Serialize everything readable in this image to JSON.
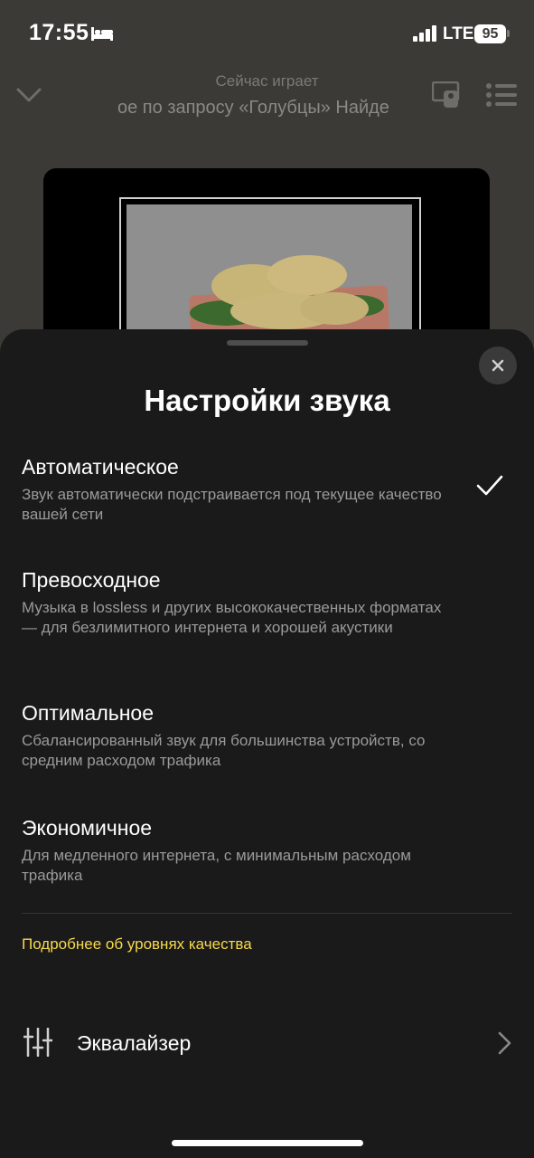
{
  "status": {
    "time": "17:55",
    "network": "LTE",
    "battery": "95"
  },
  "player": {
    "now_playing_label": "Сейчас играет",
    "track_title": "ое по запросу «Голубцы»   Найде"
  },
  "sheet": {
    "title": "Настройки звука",
    "options": [
      {
        "title": "Автоматическое",
        "description": "Звук автоматически подстраивается под текущее качество вашей сети",
        "selected": true
      },
      {
        "title": "Превосходное",
        "description": "Музыка в lossless и других высококачественных форматах — для безлимитного интернета и хорошей акустики",
        "selected": false
      },
      {
        "title": "Оптимальное",
        "description": "Сбалансированный звук для большинства устройств, со средним расходом трафика",
        "selected": false
      },
      {
        "title": "Экономичное",
        "description": "Для медленного интернета, с минимальным расходом трафика",
        "selected": false
      }
    ],
    "more_link": "Подробнее об уровнях качества",
    "equalizer_label": "Эквалайзер"
  },
  "colors": {
    "accent": "#f7d94c",
    "sheet_bg": "#1a1a1a",
    "backdrop": "#3b3a37"
  }
}
